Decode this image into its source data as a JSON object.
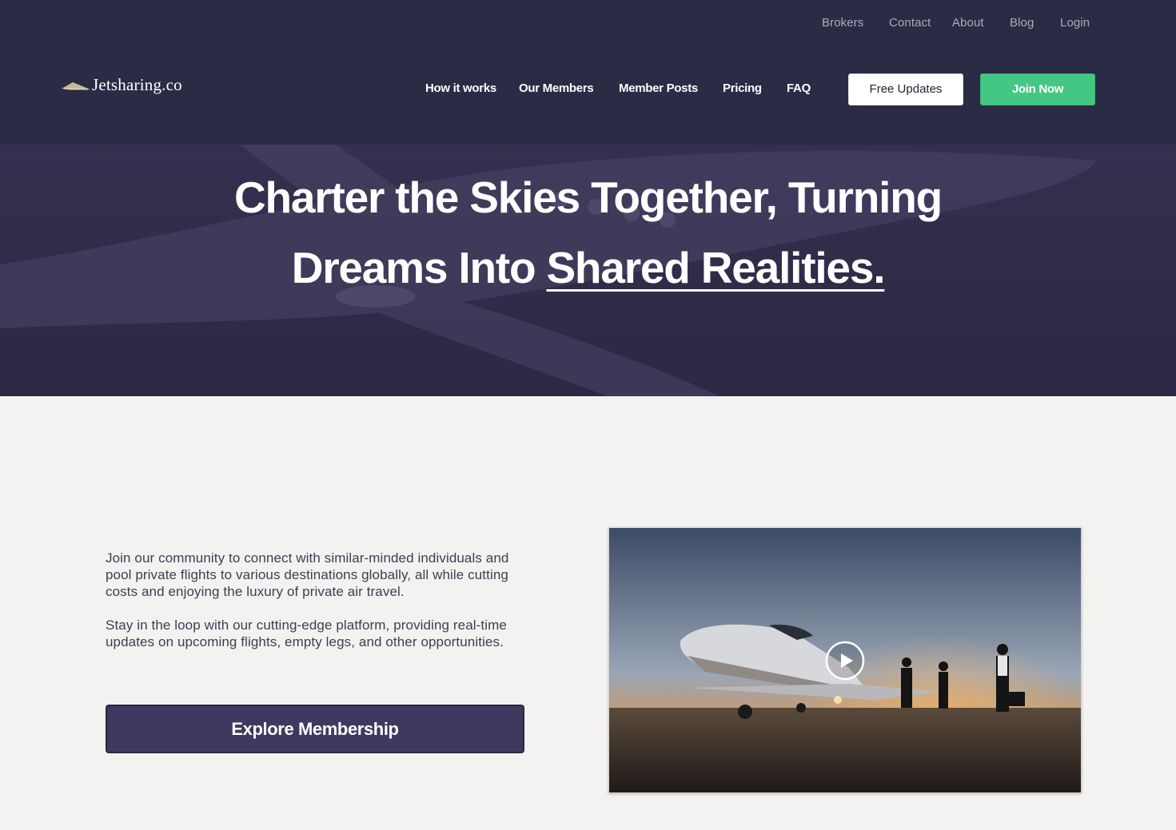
{
  "brand": {
    "name": "Jetsharing.co",
    "logo_icon": "paper-plane-icon"
  },
  "top_nav": [
    "Brokers",
    "Contact",
    "About",
    "Blog",
    "Login"
  ],
  "main_nav": [
    "How it works",
    "Our Members",
    "Member Posts",
    "Pricing",
    "FAQ"
  ],
  "header_buttons": {
    "free_updates": "Free Updates",
    "join_now": "Join Now"
  },
  "hero": {
    "line1": "Charter the Skies Together, Turning",
    "line2_prefix": "Dreams Into ",
    "line2_underlined": "Shared Realities."
  },
  "content": {
    "paragraph1": "Join our community to connect with similar-minded individuals and pool private flights to various destinations globally, all while cutting costs and enjoying the luxury of private air travel.",
    "paragraph2": "Stay in the loop with our cutting-edge platform, providing real-time updates on upcoming flights, empty legs, and other opportunities.",
    "cta": "Explore Membership"
  },
  "video": {
    "play_icon": "play-icon"
  },
  "colors": {
    "header_bg": "#2a2b45",
    "hero_bg": "#2e2c48",
    "accent_green": "#44c783",
    "cta_purple": "#3f385f",
    "page_bg": "#f3f2f0"
  }
}
